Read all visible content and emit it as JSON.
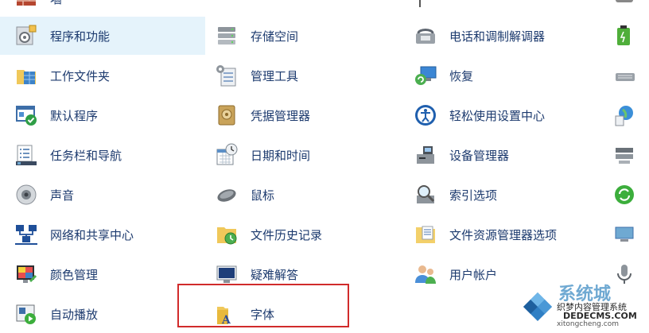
{
  "top_row": {
    "col0_partial_label": "墙"
  },
  "items": [
    {
      "name": "programs",
      "label": "程序和功能"
    },
    {
      "name": "storage",
      "label": "存储空间"
    },
    {
      "name": "phone-modem",
      "label": "电话和调制解调器"
    },
    {
      "name": "work-folders",
      "label": "工作文件夹"
    },
    {
      "name": "admin-tools",
      "label": "管理工具"
    },
    {
      "name": "recovery",
      "label": "恢复"
    },
    {
      "name": "default-programs",
      "label": "默认程序"
    },
    {
      "name": "credential-manager",
      "label": "凭据管理器"
    },
    {
      "name": "ease-of-access",
      "label": "轻松使用设置中心"
    },
    {
      "name": "taskbar",
      "label": "任务栏和导航"
    },
    {
      "name": "datetime",
      "label": "日期和时间"
    },
    {
      "name": "device-manager",
      "label": "设备管理器"
    },
    {
      "name": "sound",
      "label": "声音"
    },
    {
      "name": "mouse",
      "label": "鼠标"
    },
    {
      "name": "indexing",
      "label": "索引选项"
    },
    {
      "name": "network",
      "label": "网络和共享中心"
    },
    {
      "name": "file-history",
      "label": "文件历史记录"
    },
    {
      "name": "explorer-options",
      "label": "文件资源管理器选项"
    },
    {
      "name": "color-management",
      "label": "颜色管理"
    },
    {
      "name": "troubleshooting",
      "label": "疑难解答"
    },
    {
      "name": "user-accounts",
      "label": "用户帐户"
    },
    {
      "name": "autoplay",
      "label": "自动播放"
    },
    {
      "name": "fonts",
      "label": "字体"
    }
  ],
  "watermark": {
    "brand": "系统城",
    "line1": "织梦内容管理系统",
    "line2": "DEDECMS.COM",
    "line3": "xitongcheng.com"
  }
}
